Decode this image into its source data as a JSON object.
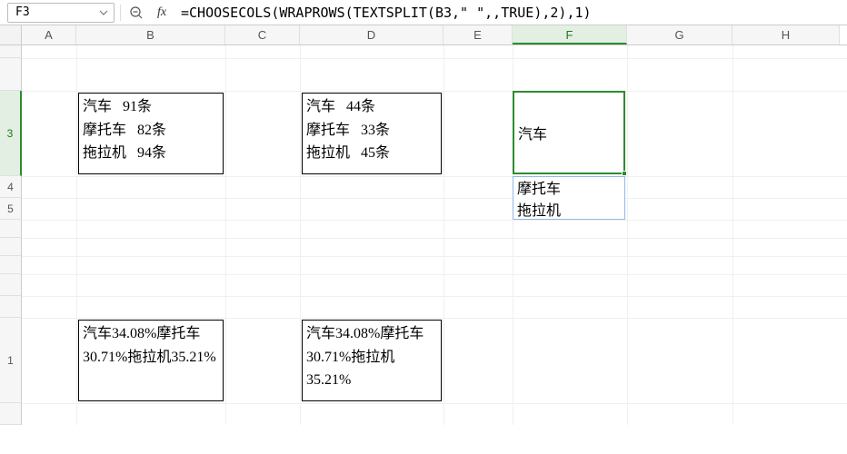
{
  "namebox": {
    "value": "F3"
  },
  "formula": {
    "value": "=CHOOSECOLS(WRAPROWS(TEXTSPLIT(B3,\" \",,TRUE),2),1)"
  },
  "fx_label": "fx",
  "columns": [
    "A",
    "B",
    "C",
    "D",
    "E",
    "F",
    "G",
    "H"
  ],
  "rows": {
    "r1": {
      "h": 14,
      "label": ""
    },
    "r2": {
      "h": 36,
      "label": ""
    },
    "r3": {
      "h": 94,
      "label": "3"
    },
    "r4": {
      "h": 24,
      "label": "4"
    },
    "r5": {
      "h": 24,
      "label": "5"
    },
    "r6": {
      "h": 20,
      "label": ""
    },
    "r7": {
      "h": 20,
      "label": ""
    },
    "r8": {
      "h": 20,
      "label": ""
    },
    "r9": {
      "h": 24,
      "label": ""
    },
    "r10": {
      "h": 24,
      "label": ""
    },
    "r11": {
      "h": 94,
      "label": "1"
    },
    "r12": {
      "h": 24,
      "label": ""
    }
  },
  "cells": {
    "B3": "汽车   91条\n摩托车   82条\n拖拉机   94条",
    "D3": "汽车   44条\n摩托车   33条\n拖拉机   45条",
    "F3": "汽车",
    "F4": "摩托车",
    "F5": "拖拉机",
    "B11": "汽车34.08%摩托车30.71%拖拉机35.21%",
    "D11": "汽车34.08%摩托车30.71%拖拉机35.21%"
  }
}
